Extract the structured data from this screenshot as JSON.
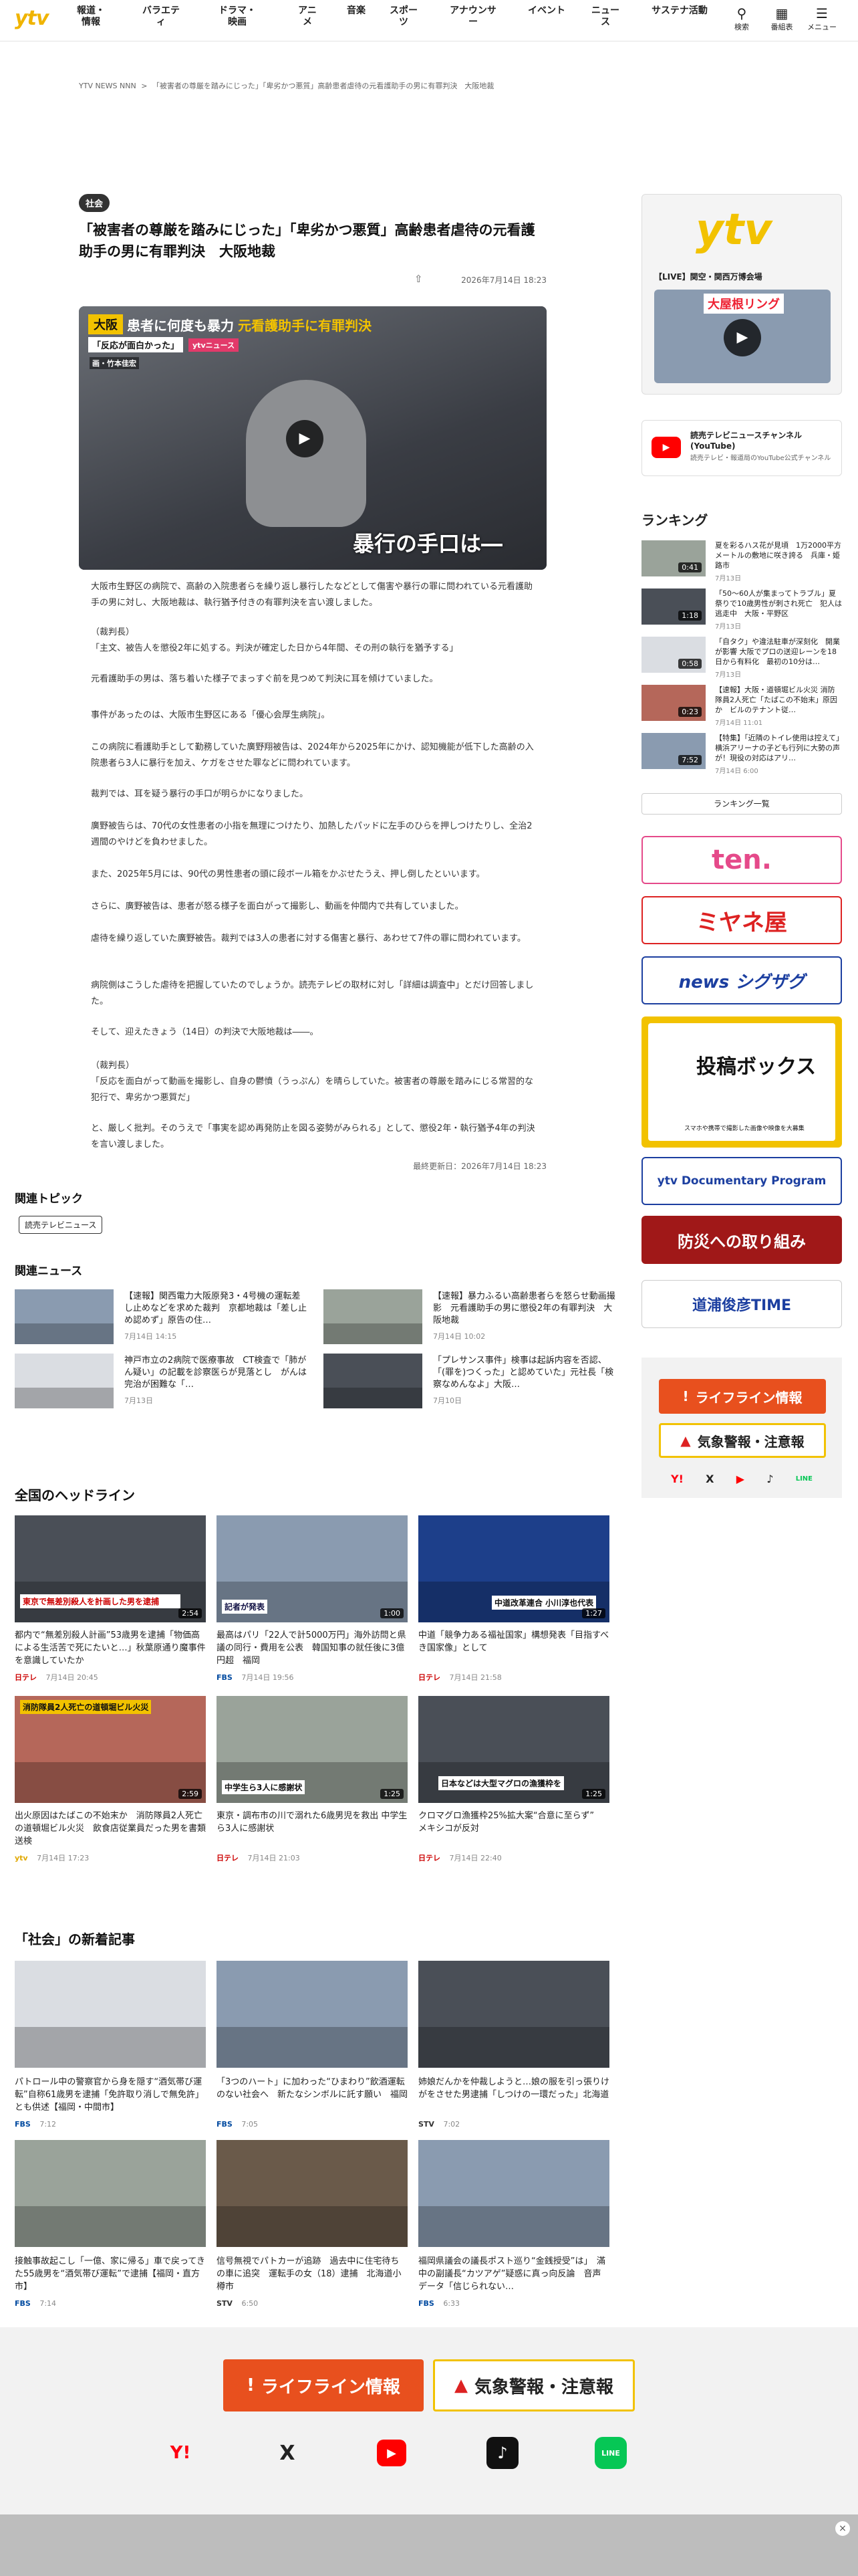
{
  "header": {
    "logo": "ytv",
    "nav": [
      {
        "label": "報道・情報"
      },
      {
        "label": "バラエティ"
      },
      {
        "label": "ドラマ・映画"
      },
      {
        "label": "アニメ"
      },
      {
        "label": "音楽"
      },
      {
        "label": "スポーツ"
      },
      {
        "label": "アナウンサー"
      },
      {
        "label": "イベント"
      },
      {
        "label": "ニュース"
      },
      {
        "label": "サステナ活動"
      }
    ],
    "utility": [
      {
        "label": "検索"
      },
      {
        "label": "番組表"
      },
      {
        "label": "メニュー"
      }
    ]
  },
  "breadcrumb": {
    "home": "YTV NEWS NNN",
    "sep": ">",
    "current": "「被害者の尊厳を踏みにじった」「卑劣かつ悪質」高齢患者虐待の元看護助手の男に有罪判決　大阪地裁"
  },
  "article": {
    "category": "社会",
    "title": "「被害者の尊厳を踏みにじった」「卑劣かつ悪質」高齢患者虐待の元看護助手の男に有罪判決　大阪地裁",
    "date": "2026年7月14日 18:23",
    "video": {
      "badge": "大阪",
      "headline": "患者に何度も暴力",
      "headline_accent": "元看護助手に有罪判決",
      "sub": "「反応が面白かった」",
      "sub2": "ytvニュース",
      "credit": "画・竹本佳宏",
      "caption": "暴行の手口は―"
    },
    "paragraphs": [
      "大阪市生野区の病院で、高齢の入院患者らを繰り返し暴行したなどとして傷害や暴行の罪に問われている元看護助手の男に対し、大阪地裁は、執行猶予付きの有罪判決を言い渡しました。",
      "（裁判長）",
      "「主文、被告人を懲役2年に処する。判決が確定した日から4年間、その刑の執行を猶予する」",
      "元看護助手の男は、落ち着いた様子でまっすぐ前を見つめて判決に耳を傾けていました。",
      "事件があったのは、大阪市生野区にある「優心会厚生病院」。",
      "この病院に看護助手として勤務していた廣野翔被告は、2024年から2025年にかけ、認知機能が低下した高齢の入院患者ら3人に暴行を加え、ケガをさせた罪などに問われています。",
      "裁判では、耳を疑う暴行の手口が明らかになりました。",
      "廣野被告らは、70代の女性患者の小指を無理につけたり、加熱したパッドに左手のひらを押しつけたりし、全治2週間のやけどを負わせました。",
      "また、2025年5月には、90代の男性患者の頭に段ボール箱をかぶせたうえ、押し倒したといいます。",
      "さらに、廣野被告は、患者が怒る様子を面白がって撮影し、動画を仲間内で共有していました。",
      "虐待を繰り返していた廣野被告。裁判では3人の患者に対する傷害と暴行、あわせて7件の罪に問われています。",
      "病院側はこうした虐待を把握していたのでしょうか。読売テレビの取材に対し「詳細は調査中」とだけ回答しました。",
      "そして、迎えたきょう（14日）の判決で大阪地裁は――。",
      "（裁判長）",
      "「反応を面白がって動画を撮影し、自身の鬱憤（うっぷん）を晴らしていた。被害者の尊厳を踏みにじる常習的な犯行で、卑劣かつ悪質だ」",
      "と、厳しく批判。そのうえで「事実を認め再発防止を図る姿勢がみられる」として、懲役2年・執行猶予4年の判決を言い渡しました。"
    ],
    "updated": "最終更新日：2026年7月14日 18:23"
  },
  "topics": {
    "heading": "関連トピック",
    "tag": "読売テレビニュース"
  },
  "related": {
    "heading": "関連ニュース",
    "items": [
      {
        "title": "【速報】関西電力大阪原発3・4号機の運転差し止めなどを求めた裁判　京都地裁は「差し止め認めず」原告の住…",
        "time": "7月14日 14:15"
      },
      {
        "title": "【速報】暴力ふるい高齢患者らを怒らせ動画撮影　元看護助手の男に懲役2年の有罪判決　大阪地裁",
        "time": "7月14日 10:02"
      },
      {
        "title": "神戸市立の2病院で医療事故　CT検査で「肺がん疑い」の記載を診察医らが見落とし　がんは完治が困難な「…",
        "time": "7月13日"
      },
      {
        "title": "「プレサンス事件」検事は起訴内容を否認、「(罪を)つくった」と認めていた」元社長「検察なめんなよ」大阪…",
        "time": "7月10日"
      }
    ]
  },
  "headlines": {
    "heading": "全国のヘッドライン",
    "items": [
      {
        "title": "都内で“無差別殺人計画”53歳男を逮捕「物価高による生活苦で死にたいと…」秋葉原通り魔事件を意識していたか",
        "source": "日テレ",
        "time": "7月14日 20:45",
        "thumb": "東京で無差別殺人を計画した男を逮捕",
        "dur": "2:54"
      },
      {
        "title": "最高はパリ「22人で計5000万円」海外訪問と県議の同行・費用を公表　韓国知事の就任後に3億円超　福岡",
        "source": "FBS",
        "time": "7月14日 19:56",
        "thumb": "記者が発表",
        "dur": "1:00"
      },
      {
        "title": "中道「競争力ある福祉国家」構想発表「目指すべき国家像」として",
        "source": "日テレ",
        "time": "7月14日 21:58",
        "thumb": "中道改革連合 小川淳也代表",
        "dur": "1:27"
      },
      {
        "title": "出火原因はたばこの不始末か　消防隊員2人死亡の道頓堀ビル火災　飲食店従業員だった男を書類送検",
        "source": "ytv",
        "time": "7月14日 17:23",
        "thumb": "消防隊員2人死亡の道頓堀ビル火災",
        "dur": "2:59"
      },
      {
        "title": "東京・調布市の川で溺れた6歳男児を救出 中学生ら3人に感謝状",
        "source": "日テレ",
        "time": "7月14日 21:03",
        "thumb": "中学生ら3人に感謝状",
        "dur": "1:25"
      },
      {
        "title": "クロマグロ漁獲枠25%拡大案“合意に至らず”　メキシコが反対",
        "source": "日テレ",
        "time": "7月14日 22:40",
        "thumb": "日本などは大型マグロの漁獲枠を",
        "dur": "1:25"
      }
    ]
  },
  "social": {
    "heading": "「社会」の新着記事",
    "items": [
      {
        "title": "パトロール中の警察官から身を隠す“酒気帯び運転”自称61歳男を逮捕「免許取り消しで無免許」とも供述【福岡・中間市】",
        "source": "FBS",
        "time": "7:12"
      },
      {
        "title": "「3つのハート」に加わった“ひまわり”飲酒運転のない社会へ　新たなシンボルに託す願い　福岡",
        "source": "FBS",
        "time": "7:05"
      },
      {
        "title": "姉娘だんかを仲裁しようと…娘の服を引っ張りけがをさせた男逮捕「しつけの一環だった」北海道",
        "source": "STV",
        "time": "7:02"
      },
      {
        "title": "接触事故起こし「一億、家に帰る」車で戻ってきた55歳男を“酒気帯び運転”で逮捕【福岡・直方市】",
        "source": "FBS",
        "time": "7:14"
      },
      {
        "title": "信号無視でパトカーが追跡　過去中に住宅待ちの車に追突　運転手の女（18）逮捕　北海道小樽市",
        "source": "STV",
        "time": "6:50"
      },
      {
        "title": "福岡県議会の議長ポスト巡り“金銭授受”は」　滿中の副議長“カツアゲ”疑惑に真っ向反論　音声データ「信じられない…",
        "source": "FBS",
        "time": "6:33"
      }
    ]
  },
  "sidebar": {
    "ad1": {
      "brand": "ytv",
      "caption": "【LIVE】関空・関西万博会場",
      "sub": "大屋根リング"
    },
    "youtube": {
      "title": "読売テレビニュースチャンネル(YouTube)",
      "desc": "読売テレビ・報道局のYouTube公式チャンネル"
    },
    "ranking": {
      "heading": "ランキング",
      "items": [
        {
          "title": "夏を彩るハス花が見頃　1万2000平方メートルの敷地に咲き誇る　兵庫・姫路市",
          "time": "7月13日",
          "dur": "0:41"
        },
        {
          "title": "「50〜60人が集まってトラブル」夏祭りで10歳男性が刺され死亡　犯人は逃走中　大阪・平野区",
          "time": "7月13日",
          "dur": "1:18"
        },
        {
          "title": "「自タク」や違法駐車が深刻化　開業が影響 大阪でプロの送迎レーンを18日から有料化　最初の10分は…",
          "time": "7月13日",
          "dur": "0:58"
        },
        {
          "title": "【速報】大阪・道頓堀ビル火災 消防隊員2人死亡「たばこの不始末」原因か　ビルのテナント従…",
          "time": "7月14日 11:01",
          "dur": "0:23"
        },
        {
          "title": "【特集】「近隣のトイレ使用は控えて」横浜アリーナの子ども行列に大勢の声が！現役の対応はアリ…",
          "time": "7月14日 6:00",
          "dur": "7:52"
        }
      ],
      "more": "ランキング一覧"
    },
    "banners": [
      {
        "label": "ten."
      },
      {
        "label": "ミヤネ屋"
      },
      {
        "label": "news シグザグ"
      },
      {
        "label": "投稿ボックス",
        "sub": "スマホや携帯で撮影した画像や映像を大募集"
      },
      {
        "label": "ytv Documentary Program"
      },
      {
        "label": "防災への取り組み"
      },
      {
        "label": "道浦俊彦TIME"
      }
    ],
    "lifeline": "ライフライン情報",
    "weather": "気象警報・注意報"
  },
  "footer": {
    "lifeline": "ライフライン情報",
    "weather": "気象警報・注意報",
    "social": [
      "Y!",
      "X",
      "▶",
      "♪",
      "LINE"
    ],
    "close": "×"
  }
}
